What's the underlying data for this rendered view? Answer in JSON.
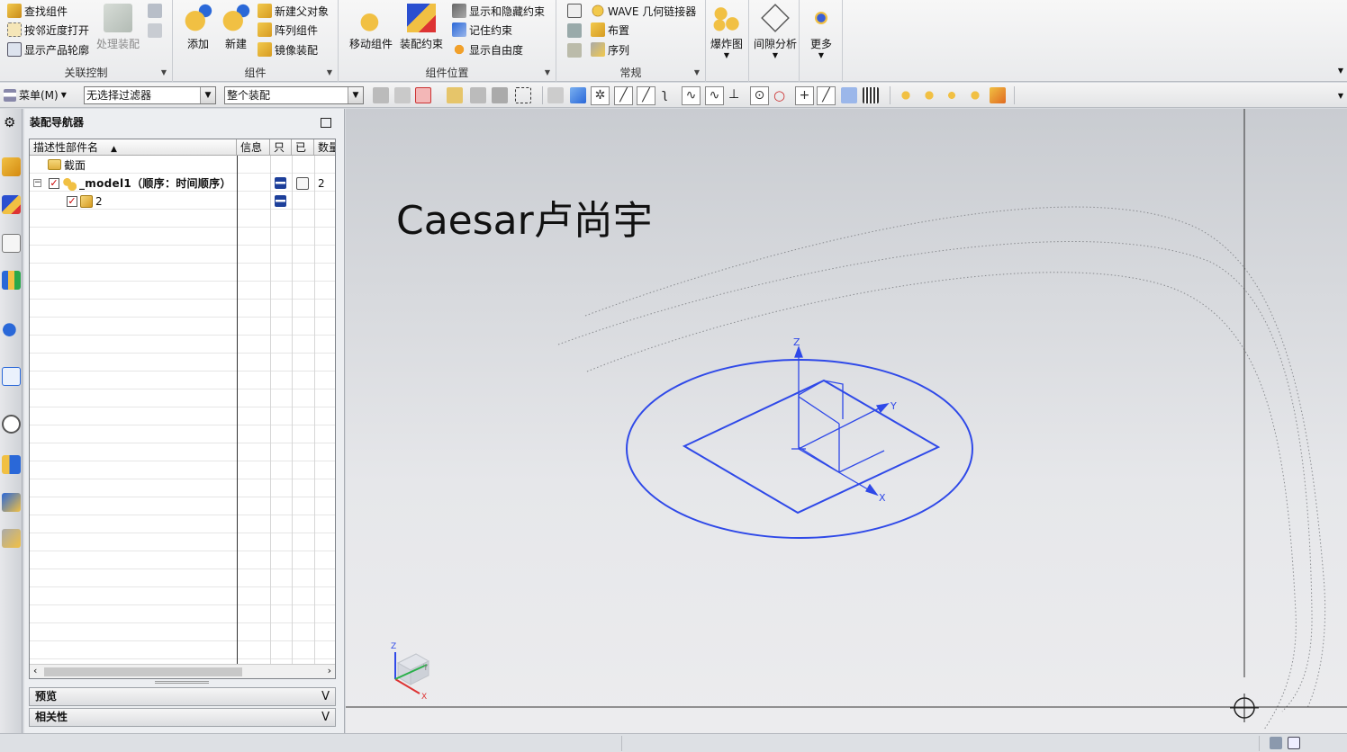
{
  "ribbon": {
    "assoc_control": {
      "find_component": "查找组件",
      "open_by_proximity": "按邻近度打开",
      "show_product_outline": "显示产品轮廓",
      "process_assembly": "处理装配",
      "label": "关联控制"
    },
    "components": {
      "add": "添加",
      "new": "新建",
      "new_parent": "新建父对象",
      "array_component": "阵列组件",
      "mirror_assembly": "镜像装配",
      "label": "组件"
    },
    "component_position": {
      "move_component": "移动组件",
      "assembly_constraint": "装配约束",
      "show_hide_constraint": "显示和隐藏约束",
      "remember_constraint": "记住约束",
      "show_dof": "显示自由度",
      "label": "组件位置"
    },
    "general": {
      "wave_linker": "WAVE 几何链接器",
      "layout": "布置",
      "sequence": "序列",
      "label": "常规"
    },
    "exploded_view": "爆炸图",
    "clearance_analysis": "间隙分析",
    "more": "更多"
  },
  "toolbar": {
    "menu": "菜单(M)",
    "filter": "无选择过滤器",
    "scope": "整个装配"
  },
  "navigator": {
    "title": "装配导航器",
    "columns": [
      "描述性部件名",
      "信息",
      "只",
      "已",
      "数量"
    ],
    "rows": [
      {
        "name": "截面",
        "qty": ""
      },
      {
        "name": "_model1（顺序：时间顺序）",
        "qty": "2"
      },
      {
        "name": "2",
        "qty": ""
      }
    ],
    "panels": {
      "preview": "预览",
      "dependency": "相关性"
    }
  },
  "canvas": {
    "watermark": "Caesar卢尚宇",
    "axis_x": "X",
    "axis_y": "Y",
    "axis_z": "Z"
  },
  "colors": {
    "sketch_blue": "#2f49e8",
    "ribbon_bg": "#efefef",
    "canvas_top": "#c9ccd1"
  }
}
